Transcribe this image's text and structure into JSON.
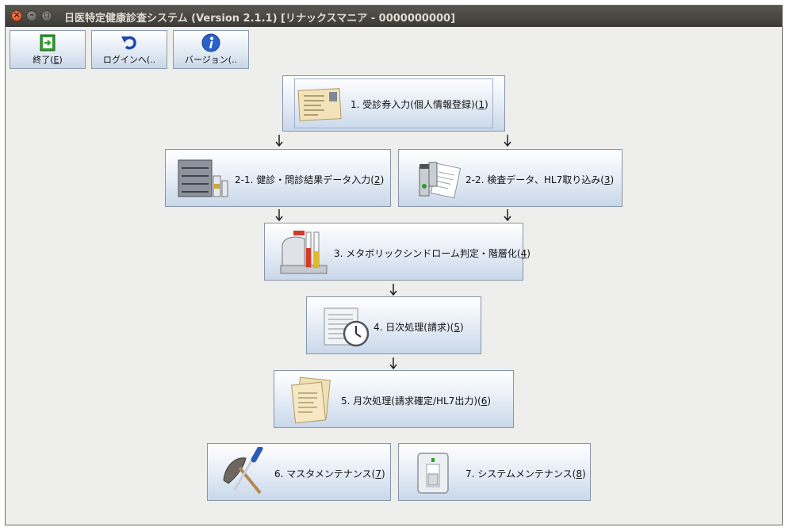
{
  "window": {
    "title": "日医特定健康診査システム (Version 2.1.1) [リナックスマニア - 0000000000]"
  },
  "toolbar": {
    "exit": {
      "label": "終了(",
      "mnemonic": "E",
      "suffix": ")",
      "icon": "exit-icon"
    },
    "login": {
      "label": "ログインへ(..",
      "icon": "undo-arrow-icon"
    },
    "version": {
      "label": "バージョン(..",
      "icon": "info-icon"
    }
  },
  "flow": {
    "step1": {
      "label": "1. 受診券入力(個人情報登録)(",
      "mnemonic": "1",
      "suffix": ")",
      "icon": "id-card-icon"
    },
    "step2_1": {
      "label": "2-1. 健診・問診結果データ入力(",
      "mnemonic": "2",
      "suffix": ")",
      "icon": "lab-rack-icon"
    },
    "step2_2": {
      "label": "2-2. 検査データ、HL7取り込み(",
      "mnemonic": "3",
      "suffix": ")",
      "icon": "sample-bottles-icon"
    },
    "step3": {
      "label": "3. メタボリックシンドローム判定・階層化(",
      "mnemonic": "4",
      "suffix": ")",
      "icon": "analyzer-icon"
    },
    "step4": {
      "label": "4. 日次処理(請求)(",
      "mnemonic": "5",
      "suffix": ")",
      "icon": "document-clock-icon"
    },
    "step5": {
      "label": "5. 月次処理(請求確定/HL7出力)(",
      "mnemonic": "6",
      "suffix": ")",
      "icon": "documents-icon"
    },
    "step6": {
      "label": "6. マスタメンテナンス(",
      "mnemonic": "7",
      "suffix": ")",
      "icon": "duster-screwdriver-icon"
    },
    "step7": {
      "label": "7. システムメンテナンス(",
      "mnemonic": "8",
      "suffix": ")",
      "icon": "wall-switch-icon"
    }
  },
  "colors": {
    "button_top": "#ffffff",
    "button_bottom": "#c9d8ea",
    "titlebar": "#3b3a36",
    "close": "#d74418"
  }
}
